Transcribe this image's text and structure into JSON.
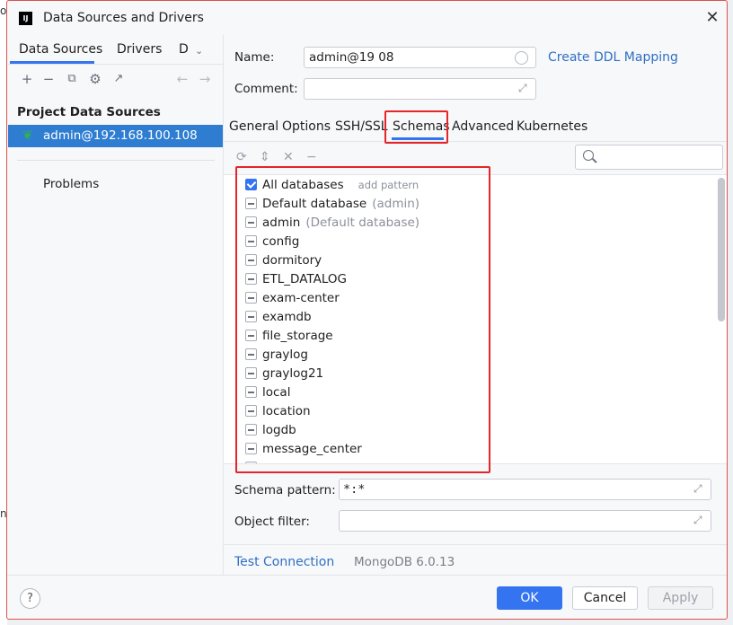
{
  "background_fragments": [
    "o",
    "n"
  ],
  "window": {
    "title": "Data Sources and Drivers",
    "app_icon_text": "IJ"
  },
  "left": {
    "tabs": [
      "Data Sources",
      "Drivers",
      "D"
    ],
    "section_title": "Project Data Sources",
    "selected_item": "admin@192.168.100.108",
    "problems_label": "Problems"
  },
  "right": {
    "name_label": "Name:",
    "name_value": "admin@19        08",
    "create_ddl_link": "Create DDL Mapping",
    "comment_label": "Comment:",
    "comment_value": "",
    "tabs": [
      "General",
      "Options",
      "SSH/SSL",
      "Schemas",
      "Advanced",
      "Kubernetes"
    ],
    "active_tab": "Schemas",
    "search_placeholder": "",
    "all_databases_label": "All databases",
    "add_pattern_label": "add pattern",
    "schemas": [
      {
        "name": "Default database",
        "hint": "(admin)"
      },
      {
        "name": "admin",
        "hint": "(Default database)"
      },
      {
        "name": "config",
        "hint": ""
      },
      {
        "name": "dormitory",
        "hint": ""
      },
      {
        "name": "ETL_DATALOG",
        "hint": ""
      },
      {
        "name": "exam-center",
        "hint": ""
      },
      {
        "name": "examdb",
        "hint": ""
      },
      {
        "name": "file_storage",
        "hint": ""
      },
      {
        "name": "graylog",
        "hint": ""
      },
      {
        "name": "graylog21",
        "hint": ""
      },
      {
        "name": "local",
        "hint": ""
      },
      {
        "name": "location",
        "hint": ""
      },
      {
        "name": "logdb",
        "hint": ""
      },
      {
        "name": "message_center",
        "hint": ""
      }
    ],
    "schema_pattern_label": "Schema pattern:",
    "schema_pattern_value": "*:*",
    "object_filter_label": "Object filter:",
    "object_filter_value": "",
    "test_connection_label": "Test Connection",
    "version_label": "MongoDB 6.0.13"
  },
  "buttons": {
    "help": "?",
    "ok": "OK",
    "cancel": "Cancel",
    "apply": "Apply"
  },
  "colors": {
    "accent": "#3574f0",
    "selection": "#2f7dd1",
    "highlight_box": "#e5252a",
    "link": "#2f6fc3"
  }
}
